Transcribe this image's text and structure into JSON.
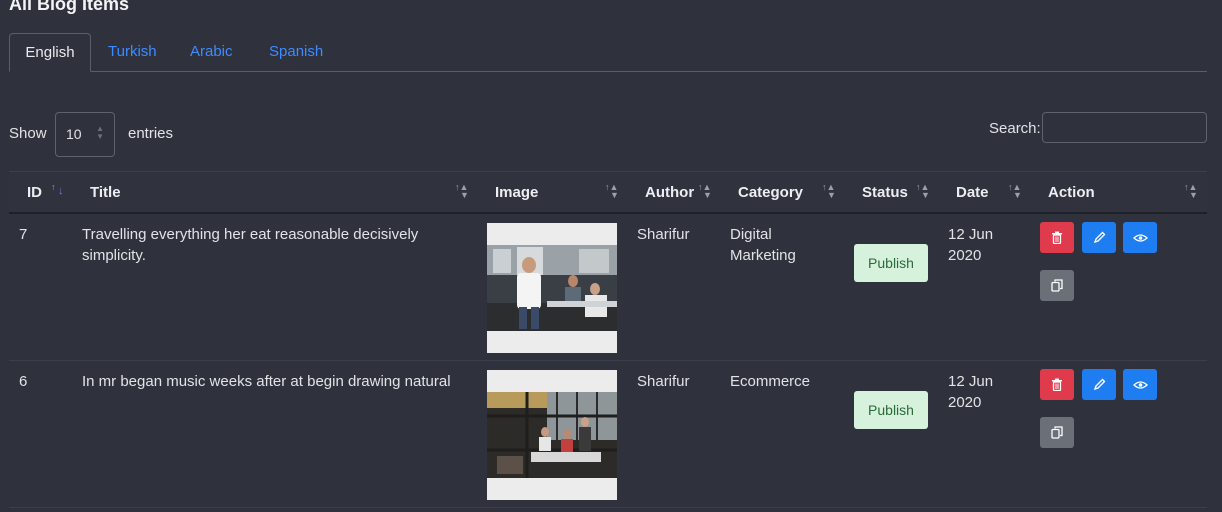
{
  "page": {
    "title": "All Blog Items"
  },
  "tabs": [
    {
      "label": "English",
      "active": true
    },
    {
      "label": "Turkish",
      "active": false
    },
    {
      "label": "Arabic",
      "active": false
    },
    {
      "label": "Spanish",
      "active": false
    }
  ],
  "controls": {
    "show_label": "Show",
    "entries_value": "10",
    "entries_label": "entries",
    "search_label": "Search:",
    "search_value": ""
  },
  "table": {
    "headers": [
      "ID",
      "Title",
      "Image",
      "Author",
      "Category",
      "Status",
      "Date",
      "Action"
    ],
    "rows": [
      {
        "id": "7",
        "title": "Travelling everything her eat reasonable decisively simplicity.",
        "author": "Sharifur",
        "category_line1": "Digital",
        "category_line2": "Marketing",
        "status": "Publish",
        "date_line1": "12 Jun",
        "date_line2": "2020"
      },
      {
        "id": "6",
        "title": "In mr began music weeks after at begin drawing natural",
        "author": "Sharifur",
        "category_line1": "Ecommerce",
        "category_line2": "",
        "status": "Publish",
        "date_line1": "12 Jun",
        "date_line2": "2020"
      }
    ]
  },
  "icons": {
    "delete": "trash-icon",
    "edit": "pencil-icon",
    "view": "eye-icon",
    "clone": "copy-icon"
  },
  "colors": {
    "background": "#2f323d",
    "link": "#3d8bff",
    "delete": "#e03a4d",
    "primary": "#1e7ef1",
    "secondary": "#6b6f78",
    "publish_bg": "#d7f2dc",
    "publish_text": "#2a6b3b"
  }
}
